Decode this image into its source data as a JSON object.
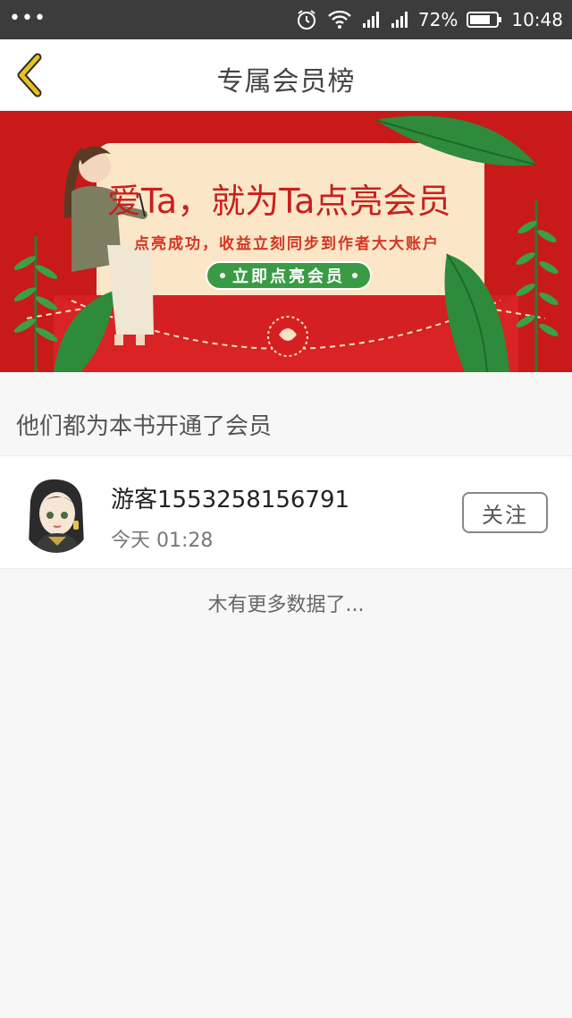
{
  "statusbar": {
    "menu_dots": "•••",
    "battery_percent": "72%",
    "time": "10:48",
    "icons": [
      "alarm-icon",
      "wifi-icon",
      "signal-icon",
      "signal-icon",
      "battery-icon"
    ]
  },
  "navbar": {
    "title": "专属会员榜",
    "back_icon": "chevron-left-icon",
    "back_color": "#e7c21f"
  },
  "banner": {
    "headline": "爱Ta，就为Ta点亮会员",
    "subline": "点亮成功，收益立刻同步到作者大大账户",
    "cta_label": "立即点亮会员",
    "background_color": "#c81a19",
    "accent_green": "#3a9b45"
  },
  "members_section": {
    "title": "他们都为本书开通了会员",
    "items": [
      {
        "name": "游客1553258156791",
        "time": "今天 01:28",
        "follow_label": "关注"
      }
    ],
    "end_text": "木有更多数据了..."
  }
}
